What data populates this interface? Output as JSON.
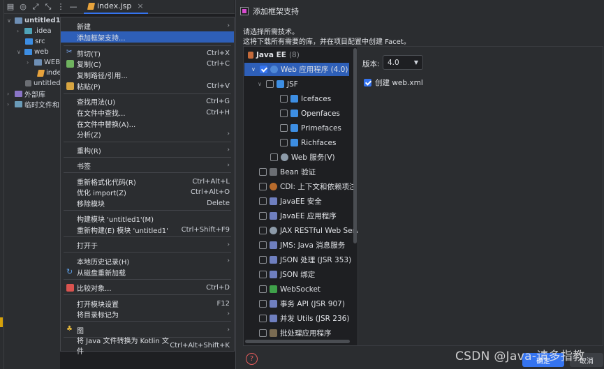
{
  "toolbar": {
    "tab_label": "index.jsp",
    "tab_close": "×"
  },
  "tree": {
    "items": [
      {
        "label": "untitled1",
        "chev": "∨"
      },
      {
        "label": ".idea",
        "chev": "›"
      },
      {
        "label": "src",
        "chev": ""
      },
      {
        "label": "web",
        "chev": "∨"
      },
      {
        "label": "WEB",
        "chev": "›"
      },
      {
        "label": "inde",
        "chev": ""
      },
      {
        "label": "untitled",
        "chev": ""
      },
      {
        "label": "外部库",
        "chev": "›"
      },
      {
        "label": "临时文件和",
        "chev": "›"
      }
    ]
  },
  "menu": {
    "items": [
      {
        "label": "新建",
        "shortcut": "",
        "submenu": true
      },
      {
        "label": "添加框架支持...",
        "shortcut": "",
        "submenu": false
      },
      {
        "label": "剪切(T)",
        "shortcut": "Ctrl+X",
        "submenu": false
      },
      {
        "label": "复制(C)",
        "shortcut": "Ctrl+C",
        "submenu": false
      },
      {
        "label": "复制路径/引用...",
        "shortcut": "",
        "submenu": false
      },
      {
        "label": "粘贴(P)",
        "shortcut": "Ctrl+V",
        "submenu": false
      },
      {
        "label": "查找用法(U)",
        "shortcut": "Ctrl+G",
        "submenu": false
      },
      {
        "label": "在文件中查找...",
        "shortcut": "Ctrl+H",
        "submenu": false
      },
      {
        "label": "在文件中替换(A)...",
        "shortcut": "",
        "submenu": false
      },
      {
        "label": "分析(Z)",
        "shortcut": "",
        "submenu": true
      },
      {
        "label": "重构(R)",
        "shortcut": "",
        "submenu": true
      },
      {
        "label": "书签",
        "shortcut": "",
        "submenu": true
      },
      {
        "label": "重新格式化代码(R)",
        "shortcut": "Ctrl+Alt+L",
        "submenu": false
      },
      {
        "label": "优化 import(Z)",
        "shortcut": "Ctrl+Alt+O",
        "submenu": false
      },
      {
        "label": "移除模块",
        "shortcut": "Delete",
        "submenu": false
      },
      {
        "label": "构建模块 'untitled1'(M)",
        "shortcut": "",
        "submenu": false
      },
      {
        "label": "重新构建(E) 模块 'untitled1'",
        "shortcut": "Ctrl+Shift+F9",
        "submenu": false
      },
      {
        "label": "打开于",
        "shortcut": "",
        "submenu": true
      },
      {
        "label": "本地历史记录(H)",
        "shortcut": "",
        "submenu": true
      },
      {
        "label": "从磁盘重新加载",
        "shortcut": "",
        "submenu": false
      },
      {
        "label": "比较对象...",
        "shortcut": "Ctrl+D",
        "submenu": false
      },
      {
        "label": "打开模块设置",
        "shortcut": "F12",
        "submenu": false
      },
      {
        "label": "将目录标记为",
        "shortcut": "",
        "submenu": true
      },
      {
        "label": "图",
        "shortcut": "",
        "submenu": true
      },
      {
        "label": "将 Java 文件转换为 Kotlin 文件",
        "shortcut": "Ctrl+Alt+Shift+K",
        "submenu": false
      }
    ],
    "arrow": "›"
  },
  "dialog": {
    "title": "添加框架支持",
    "desc1": "请选择所需技术。",
    "desc2": "这将下载所有需要的库，并在项目配置中创建 Facet。",
    "group_label": "Java EE",
    "group_count": "(8)",
    "frameworks": [
      {
        "label": "Web 应用程序 (4.0)",
        "checked": true
      },
      {
        "label": "JSF",
        "checked": false
      },
      {
        "label": "Icefaces",
        "checked": false
      },
      {
        "label": "Openfaces",
        "checked": false
      },
      {
        "label": "Primefaces",
        "checked": false
      },
      {
        "label": "Richfaces",
        "checked": false
      },
      {
        "label": "Web 服务(V)",
        "checked": false
      },
      {
        "label": "Bean 验证",
        "checked": false
      },
      {
        "label": "CDI: 上下文和依赖项注",
        "checked": false
      },
      {
        "label": "JavaEE 安全",
        "checked": false
      },
      {
        "label": "JavaEE 应用程序",
        "checked": false
      },
      {
        "label": "JAX RESTful Web Serv",
        "checked": false
      },
      {
        "label": "JMS: Java 消息服务",
        "checked": false
      },
      {
        "label": "JSON 处理 (JSR 353)",
        "checked": false
      },
      {
        "label": "JSON 绑定",
        "checked": false
      },
      {
        "label": "WebSocket",
        "checked": false
      },
      {
        "label": "事务 API (JSR 907)",
        "checked": false
      },
      {
        "label": "并发 Utils (JSR 236)",
        "checked": false
      },
      {
        "label": "批处理应用程序",
        "checked": false
      }
    ],
    "version_label": "版本:",
    "version_value": "4.0",
    "create_webxml": "创建 web.xml",
    "ok_label": "确定",
    "cancel_label": "取消",
    "help": "?"
  },
  "watermark": "CSDN @Java-请多指教"
}
